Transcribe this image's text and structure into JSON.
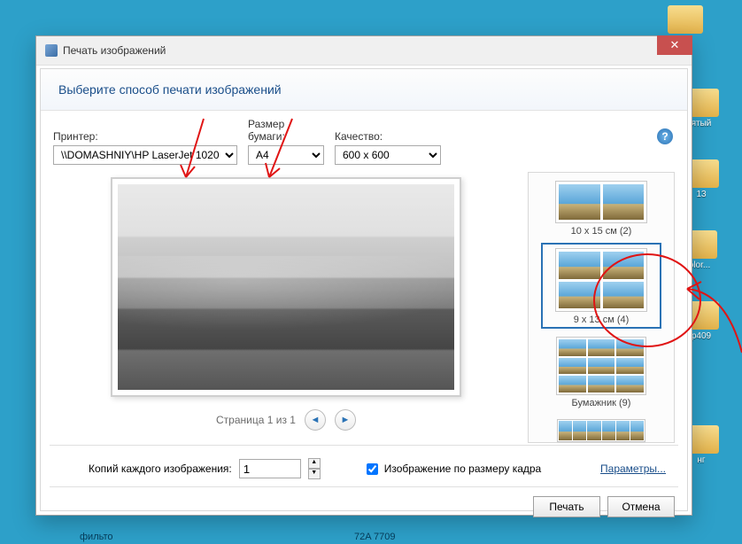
{
  "window": {
    "title": "Печать изображений"
  },
  "header": {
    "subtitle": "Выберите способ печати изображений"
  },
  "controls": {
    "printer_label": "Принтер:",
    "printer_value": "\\\\DOMASHNIY\\HP LaserJet 1020",
    "paper_label": "Размер бумаги:",
    "paper_value": "A4",
    "quality_label": "Качество:",
    "quality_value": "600 x 600"
  },
  "pager": {
    "text": "Страница 1 из 1"
  },
  "layouts": [
    {
      "id": "10x15x2",
      "label": "10 x 15 см (2)",
      "grid": 2
    },
    {
      "id": "9x13x4",
      "label": "9 x 13 см (4)",
      "grid": 4,
      "selected": true
    },
    {
      "id": "wallet9",
      "label": "Бумажник (9)",
      "grid": 9
    },
    {
      "id": "contact",
      "label": "",
      "grid": "strip"
    }
  ],
  "footer": {
    "copies_label": "Копий каждого изображения:",
    "copies_value": "1",
    "fit_label": "Изображение по размеру кадра",
    "fit_checked": true,
    "params_link": "Параметры...",
    "print_btn": "Печать",
    "cancel_btn": "Отмена"
  },
  "desktop_icons": {
    "i1": "",
    "i2": "ятый",
    "i3": "13",
    "i4": "olor...",
    "i5": "p409",
    "i6": "нг"
  },
  "statusbar": {
    "left": "фильто",
    "mid": "72A 7709"
  }
}
